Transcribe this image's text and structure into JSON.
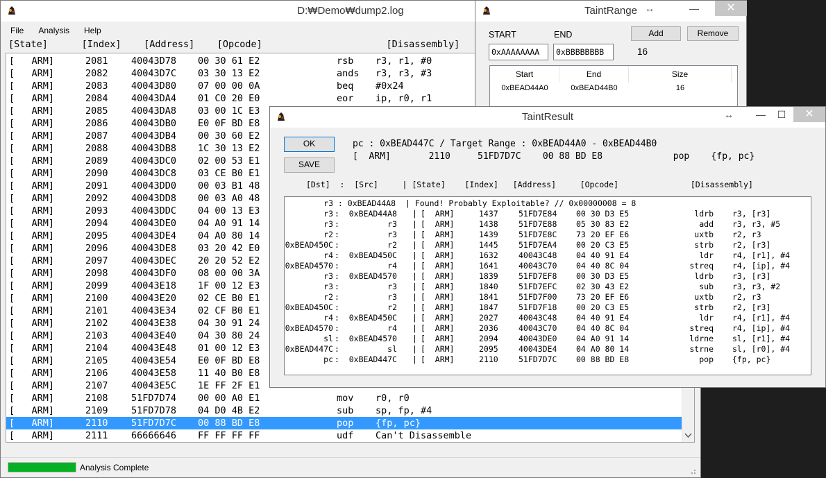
{
  "main": {
    "title": "D:₩Demo₩dump2.log",
    "menu": [
      "File",
      "Analysis",
      "Help"
    ],
    "header": "[State]      [Index]    [Address]    [Opcode]                      [Disassembly]",
    "rows": [
      {
        "state": "[   ARM]",
        "index": "2081",
        "addr": "40043D78",
        "op": "00 30 61 E2",
        "mn": "rsb",
        "args": "r3, r1, #0"
      },
      {
        "state": "[   ARM]",
        "index": "2082",
        "addr": "40043D7C",
        "op": "03 30 13 E2",
        "mn": "ands",
        "args": "r3, r3, #3"
      },
      {
        "state": "[   ARM]",
        "index": "2083",
        "addr": "40043D80",
        "op": "07 00 00 0A",
        "mn": "beq",
        "args": "#0x24"
      },
      {
        "state": "[   ARM]",
        "index": "2084",
        "addr": "40043DA4",
        "op": "01 C0 20 E0",
        "mn": "eor",
        "args": "ip, r0, r1"
      },
      {
        "state": "[   ARM]",
        "index": "2085",
        "addr": "40043DA8",
        "op": "03 00 1C E3",
        "mn": "",
        "args": ""
      },
      {
        "state": "[   ARM]",
        "index": "2086",
        "addr": "40043DB0",
        "op": "E0 0F BD E8",
        "mn": "",
        "args": ""
      },
      {
        "state": "[   ARM]",
        "index": "2087",
        "addr": "40043DB4",
        "op": "00 30 60 E2",
        "mn": "",
        "args": ""
      },
      {
        "state": "[   ARM]",
        "index": "2088",
        "addr": "40043DB8",
        "op": "1C 30 13 E2",
        "mn": "",
        "args": ""
      },
      {
        "state": "[   ARM]",
        "index": "2089",
        "addr": "40043DC0",
        "op": "02 00 53 E1",
        "mn": "",
        "args": ""
      },
      {
        "state": "[   ARM]",
        "index": "2090",
        "addr": "40043DC8",
        "op": "03 CE B0 E1",
        "mn": "",
        "args": ""
      },
      {
        "state": "[   ARM]",
        "index": "2091",
        "addr": "40043DD0",
        "op": "00 03 B1 48",
        "mn": "",
        "args": ""
      },
      {
        "state": "[   ARM]",
        "index": "2092",
        "addr": "40043DD8",
        "op": "00 03 A0 48",
        "mn": "",
        "args": ""
      },
      {
        "state": "[   ARM]",
        "index": "2093",
        "addr": "40043DDC",
        "op": "04 00 13 E3",
        "mn": "",
        "args": ""
      },
      {
        "state": "[   ARM]",
        "index": "2094",
        "addr": "40043DE0",
        "op": "04 A0 91 14",
        "mn": "",
        "args": ""
      },
      {
        "state": "[   ARM]",
        "index": "2095",
        "addr": "40043DE4",
        "op": "04 A0 80 14",
        "mn": "",
        "args": ""
      },
      {
        "state": "[   ARM]",
        "index": "2096",
        "addr": "40043DE8",
        "op": "03 20 42 E0",
        "mn": "",
        "args": ""
      },
      {
        "state": "[   ARM]",
        "index": "2097",
        "addr": "40043DEC",
        "op": "20 20 52 E2",
        "mn": "",
        "args": ""
      },
      {
        "state": "[   ARM]",
        "index": "2098",
        "addr": "40043DF0",
        "op": "08 00 00 3A",
        "mn": "",
        "args": ""
      },
      {
        "state": "[   ARM]",
        "index": "2099",
        "addr": "40043E18",
        "op": "1F 00 12 E3",
        "mn": "",
        "args": ""
      },
      {
        "state": "[   ARM]",
        "index": "2100",
        "addr": "40043E20",
        "op": "02 CE B0 E1",
        "mn": "",
        "args": ""
      },
      {
        "state": "[   ARM]",
        "index": "2101",
        "addr": "40043E34",
        "op": "02 CF B0 E1",
        "mn": "",
        "args": ""
      },
      {
        "state": "[   ARM]",
        "index": "2102",
        "addr": "40043E38",
        "op": "04 30 91 24",
        "mn": "",
        "args": ""
      },
      {
        "state": "[   ARM]",
        "index": "2103",
        "addr": "40043E40",
        "op": "04 30 80 24",
        "mn": "",
        "args": ""
      },
      {
        "state": "[   ARM]",
        "index": "2104",
        "addr": "40043E48",
        "op": "01 00 12 E3",
        "mn": "",
        "args": ""
      },
      {
        "state": "[   ARM]",
        "index": "2105",
        "addr": "40043E54",
        "op": "E0 0F BD E8",
        "mn": "",
        "args": ""
      },
      {
        "state": "[   ARM]",
        "index": "2106",
        "addr": "40043E58",
        "op": "11 40 B0 E8",
        "mn": "",
        "args": ""
      },
      {
        "state": "[   ARM]",
        "index": "2107",
        "addr": "40043E5C",
        "op": "1E FF 2F E1",
        "mn": "",
        "args": ""
      },
      {
        "state": "[   ARM]",
        "index": "2108",
        "addr": "51FD7D74",
        "op": "00 00 A0 E1",
        "mn": "mov",
        "args": "r0, r0"
      },
      {
        "state": "[   ARM]",
        "index": "2109",
        "addr": "51FD7D78",
        "op": "04 D0 4B E2",
        "mn": "sub",
        "args": "sp, fp, #4"
      },
      {
        "state": "[   ARM]",
        "index": "2110",
        "addr": "51FD7D7C",
        "op": "00 88 BD E8",
        "mn": "pop",
        "args": "{fp, pc}"
      },
      {
        "state": "[   ARM]",
        "index": "2111",
        "addr": "66666646",
        "op": "FF FF FF FF",
        "mn": "udf",
        "args": "Can't Disassemble"
      }
    ],
    "selected_index": 29,
    "status": "Analysis Complete",
    "progress_fraction": 1.0
  },
  "taint_range": {
    "title": "TaintRange",
    "start_label": "START",
    "end_label": "END",
    "start_value": "0xAAAAAAAA",
    "end_value": "0xBBBBBBBB",
    "size_value": "16",
    "add_label": "Add",
    "remove_label": "Remove",
    "columns": [
      "Start",
      "End",
      "Size"
    ],
    "rows": [
      {
        "start": "0xBEAD44A0",
        "end": "0xBEAD44B0",
        "size": "16"
      }
    ]
  },
  "taint_result": {
    "title": "TaintResult",
    "ok_label": "OK",
    "save_label": "SAVE",
    "info_line1": "pc : 0xBEAD447C / Target Range : 0xBEAD44A0 - 0xBEAD44B0",
    "info_line2": "[  ARM]       2110     51FD7D7C    00 88 BD E8             pop    {fp, pc}",
    "header": "[Dst]  :  [Src]     | [State]    [Index]   [Address]     [Opcode]               [Disassembly]",
    "first_row": {
      "dst": "r3",
      "src": "0xBEAD44A8",
      "text": "Found! Probably Exploitable? // 0x00000008 = 8"
    },
    "rows": [
      {
        "dst": "r3",
        "src": "0xBEAD44A8",
        "state": "[  ARM]",
        "index": "1437",
        "addr": "51FD7E84",
        "op": "00 30 D3 E5",
        "mn": "ldrb",
        "args": "r3, [r3]"
      },
      {
        "dst": "r3",
        "src": "r3",
        "state": "[  ARM]",
        "index": "1438",
        "addr": "51FD7E88",
        "op": "05 30 83 E2",
        "mn": "add",
        "args": "r3, r3, #5"
      },
      {
        "dst": "r2",
        "src": "r3",
        "state": "[  ARM]",
        "index": "1439",
        "addr": "51FD7E8C",
        "op": "73 20 EF E6",
        "mn": "uxtb",
        "args": "r2, r3"
      },
      {
        "dst": "0xBEAD450C",
        "src": "r2",
        "state": "[  ARM]",
        "index": "1445",
        "addr": "51FD7EA4",
        "op": "00 20 C3 E5",
        "mn": "strb",
        "args": "r2, [r3]"
      },
      {
        "dst": "r4",
        "src": "0xBEAD450C",
        "state": "[  ARM]",
        "index": "1632",
        "addr": "40043C48",
        "op": "04 40 91 E4",
        "mn": "ldr",
        "args": "r4, [r1], #4"
      },
      {
        "dst": "0xBEAD4570",
        "src": "r4",
        "state": "[  ARM]",
        "index": "1641",
        "addr": "40043C70",
        "op": "04 40 8C 04",
        "mn": "streq",
        "args": "r4, [ip], #4"
      },
      {
        "dst": "r3",
        "src": "0xBEAD4570",
        "state": "[  ARM]",
        "index": "1839",
        "addr": "51FD7EF8",
        "op": "00 30 D3 E5",
        "mn": "ldrb",
        "args": "r3, [r3]"
      },
      {
        "dst": "r3",
        "src": "r3",
        "state": "[  ARM]",
        "index": "1840",
        "addr": "51FD7EFC",
        "op": "02 30 43 E2",
        "mn": "sub",
        "args": "r3, r3, #2"
      },
      {
        "dst": "r2",
        "src": "r3",
        "state": "[  ARM]",
        "index": "1841",
        "addr": "51FD7F00",
        "op": "73 20 EF E6",
        "mn": "uxtb",
        "args": "r2, r3"
      },
      {
        "dst": "0xBEAD450C",
        "src": "r2",
        "state": "[  ARM]",
        "index": "1847",
        "addr": "51FD7F18",
        "op": "00 20 C3 E5",
        "mn": "strb",
        "args": "r2, [r3]"
      },
      {
        "dst": "r4",
        "src": "0xBEAD450C",
        "state": "[  ARM]",
        "index": "2027",
        "addr": "40043C48",
        "op": "04 40 91 E4",
        "mn": "ldr",
        "args": "r4, [r1], #4"
      },
      {
        "dst": "0xBEAD4570",
        "src": "r4",
        "state": "[  ARM]",
        "index": "2036",
        "addr": "40043C70",
        "op": "04 40 8C 04",
        "mn": "streq",
        "args": "r4, [ip], #4"
      },
      {
        "dst": "sl",
        "src": "0xBEAD4570",
        "state": "[  ARM]",
        "index": "2094",
        "addr": "40043DE0",
        "op": "04 A0 91 14",
        "mn": "ldrne",
        "args": "sl, [r1], #4"
      },
      {
        "dst": "0xBEAD447C",
        "src": "sl",
        "state": "[  ARM]",
        "index": "2095",
        "addr": "40043DE4",
        "op": "04 A0 80 14",
        "mn": "strne",
        "args": "sl, [r0], #4"
      },
      {
        "dst": "pc",
        "src": "0xBEAD447C",
        "state": "[  ARM]",
        "index": "2110",
        "addr": "51FD7D7C",
        "op": "00 88 BD E8",
        "mn": "pop",
        "args": "{fp, pc}"
      }
    ]
  },
  "window_controls": {
    "minimize": "—",
    "maximize": "☐",
    "close": "✕",
    "resize": "↔"
  },
  "colors": {
    "selection": "#3399ff",
    "progress": "#06b025"
  }
}
